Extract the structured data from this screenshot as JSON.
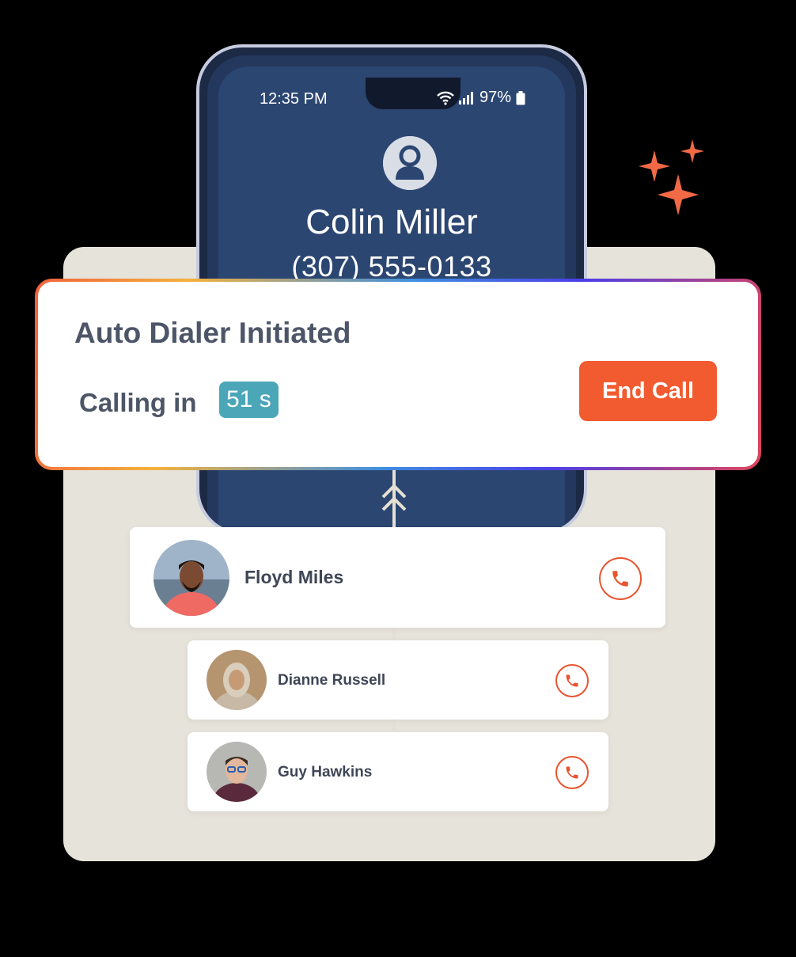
{
  "phone": {
    "status_time": "12:35 PM",
    "battery": "97%",
    "caller_name": "Colin Miller",
    "caller_number": "(307) 555-0133"
  },
  "notification": {
    "title": "Auto Dialer Initiated",
    "calling_label": "Calling in",
    "countdown": "51 s",
    "end_call_label": "End Call"
  },
  "contacts": [
    {
      "name": "Floyd Miles"
    },
    {
      "name": "Dianne Russell"
    },
    {
      "name": "Guy Hawkins"
    }
  ],
  "colors": {
    "accent": "#f25a2f",
    "countdown_badge": "#4ba6b8",
    "phone_screen": "#2c4672",
    "backdrop": "#e6e3da"
  },
  "icons": [
    "wifi-icon",
    "signal-icon",
    "battery-icon",
    "user-icon",
    "phone-icon",
    "sparkle-icon",
    "chevron-up-icon"
  ]
}
